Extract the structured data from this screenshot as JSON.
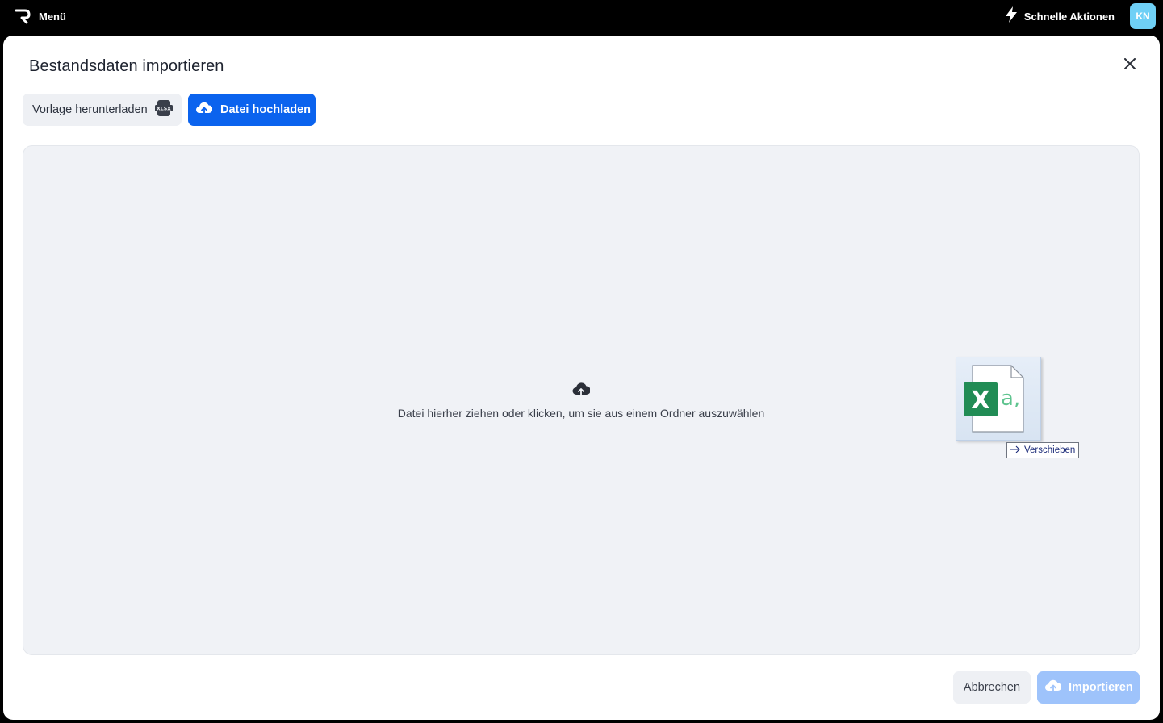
{
  "topbar": {
    "menu_label": "Menü",
    "quick_actions_label": "Schnelle Aktionen",
    "avatar_initials": "KN",
    "logo_icon": "brand-logo-icon",
    "quick_actions_icon": "lightning-bolt-icon"
  },
  "modal": {
    "title": "Bestandsdaten importieren",
    "close_icon": "close-icon",
    "template_button_label": "Vorlage herunterladen",
    "template_button_icon": "xlsx-file-icon",
    "template_icon_text": "XLSX",
    "upload_button_label": "Datei hochladen",
    "upload_button_icon": "cloud-upload-icon",
    "dropzone": {
      "text": "Datei hierher ziehen oder klicken, um sie aus einem Ordner auszuwählen",
      "icon": "cloud-upload-icon"
    },
    "drag_ghost": {
      "icon": "excel-file-icon",
      "excel_letter": "X",
      "excel_suffix": "a,",
      "tooltip": "Verschieben",
      "tooltip_icon": "arrow-right-icon"
    },
    "cancel_label": "Abbrechen",
    "import_label": "Importieren",
    "import_icon": "cloud-upload-icon"
  },
  "colors": {
    "primary": "#0b63ee",
    "primary_disabled": "#9ec3fb",
    "avatar": "#6fd0f6",
    "excel_green": "#218c55",
    "dropzone_bg": "#f0f2f6",
    "topbar_bg": "#000000"
  }
}
